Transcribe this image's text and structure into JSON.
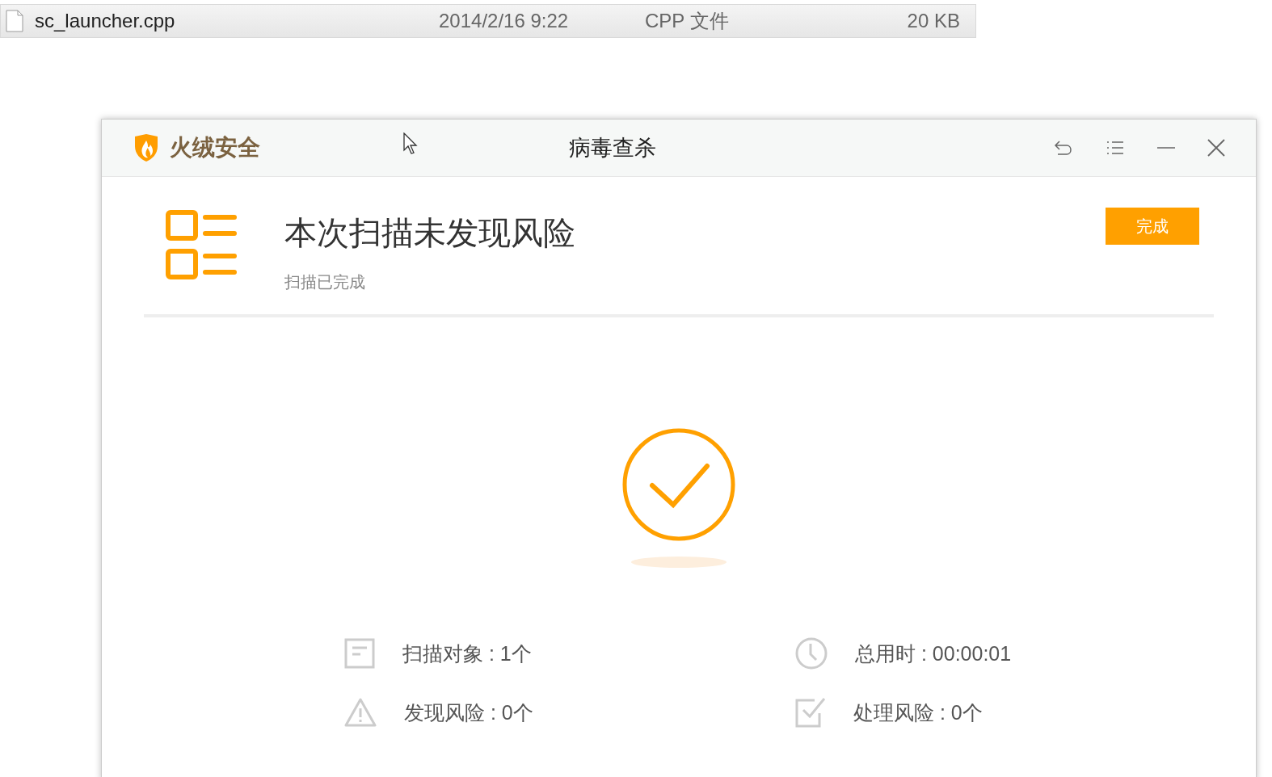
{
  "file_row": {
    "name": "sc_launcher.cpp",
    "modified": "2014/2/16 9:22",
    "type": "CPP 文件",
    "size": "20 KB"
  },
  "window": {
    "brand": "火绒安全",
    "title": "病毒查杀"
  },
  "result": {
    "heading": "本次扫描未发现风险",
    "subtitle": "扫描已完成",
    "button": "完成"
  },
  "stats": [
    {
      "kind": "document",
      "text": "扫描对象 : 1个"
    },
    {
      "kind": "clock",
      "text": "总用时 : 00:00:01"
    },
    {
      "kind": "warning",
      "text": "发现风险 : 0个"
    },
    {
      "kind": "check",
      "text": "处理风险 : 0个"
    }
  ]
}
